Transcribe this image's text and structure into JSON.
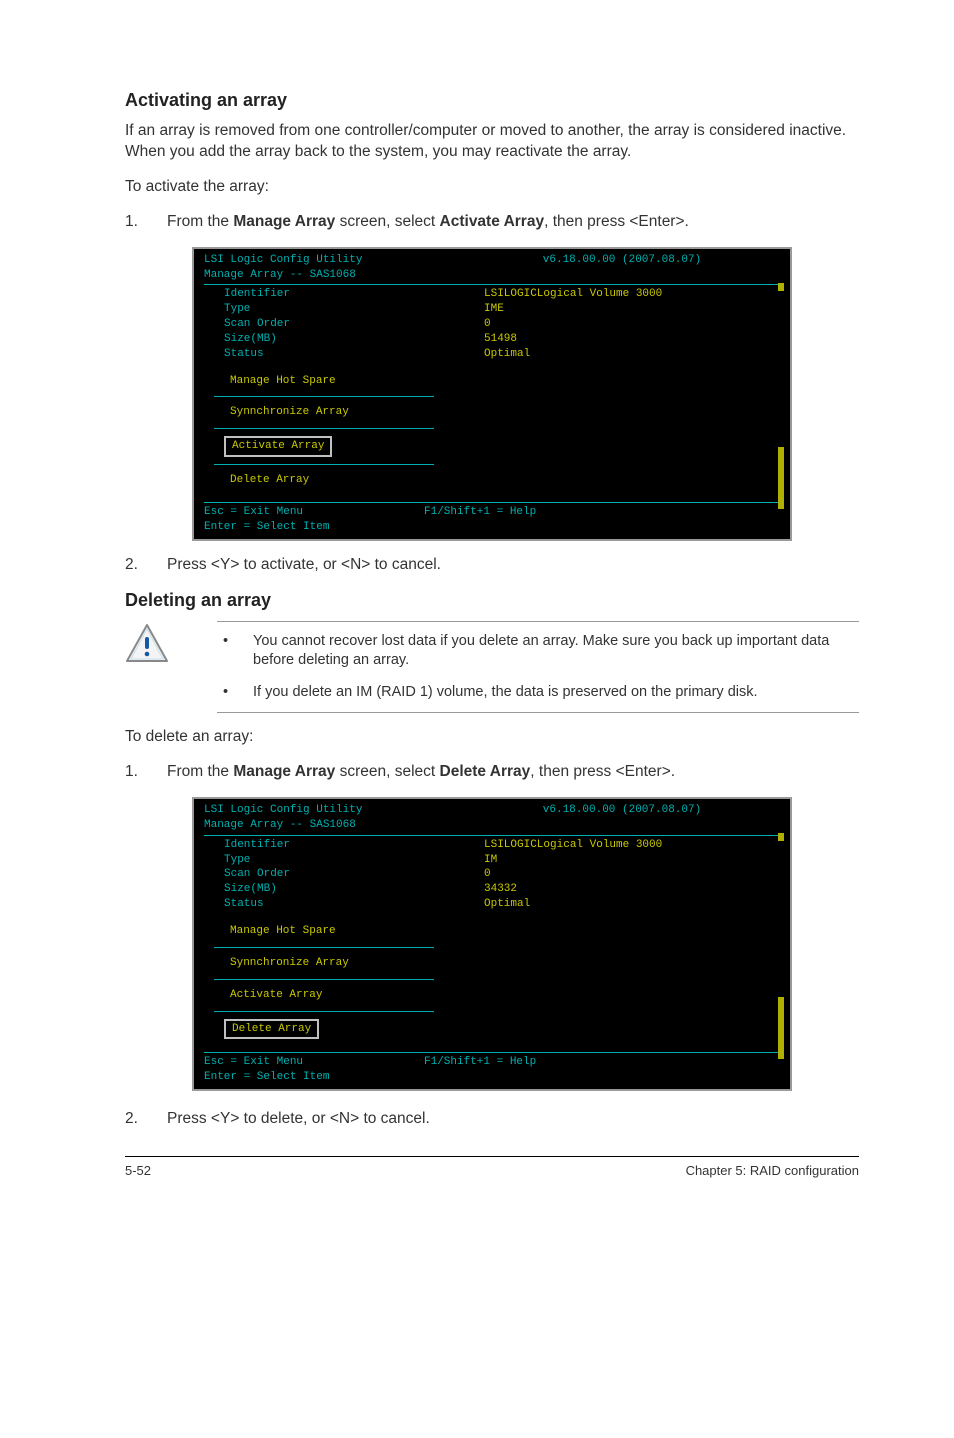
{
  "section1": {
    "heading": "Activating an array",
    "para1": "If an array is removed from one controller/computer or moved to another, the array is considered inactive. When you add the array back to the system, you may reactivate the array.",
    "para2": "To activate the array:",
    "step1_num": "1.",
    "step1_pre": "From the ",
    "step1_b1": "Manage Array",
    "step1_mid": " screen, select ",
    "step1_b2": "Activate Array",
    "step1_post": ", then press <Enter>.",
    "step2_num": "2.",
    "step2_text": "Press <Y> to activate, or <N> to cancel."
  },
  "terminal1": {
    "title_left": "LSI Logic Config Utility",
    "title_right": "v6.18.00.00 (2007.08.07)",
    "subtitle": "Manage Array -- SAS1068",
    "rows": {
      "identifier_label": "Identifier",
      "identifier_val": "LSILOGICLogical Volume  3000",
      "type_label": "Type",
      "type_val": "IME",
      "scan_label": "Scan Order",
      "scan_val": "0",
      "size_label": "Size(MB)",
      "size_val": "51498",
      "status_label": "Status",
      "status_val": "Optimal"
    },
    "menu": {
      "hot_spare": "Manage Hot Spare",
      "sync": "Synnchronize Array",
      "activate": "Activate Array",
      "delete": "Delete Array"
    },
    "footer": {
      "esc": "Esc = Exit Menu",
      "f1": "F1/Shift+1 = Help",
      "enter": "Enter = Select Item"
    }
  },
  "section2": {
    "heading": "Deleting an array",
    "callout_li1": "You cannot recover lost data if you delete an array. Make sure you back up important data before deleting an array.",
    "callout_li2": "If you delete an IM (RAID 1) volume, the data is preserved on the primary disk.",
    "para1": "To delete an array:",
    "step1_num": "1.",
    "step1_pre": "From the ",
    "step1_b1": "Manage Array",
    "step1_mid": " screen, select ",
    "step1_b2": "Delete Array",
    "step1_post": ", then press <Enter>.",
    "step2_num": "2.",
    "step2_text": "Press <Y> to delete, or <N> to cancel."
  },
  "terminal2": {
    "title_left": "LSI Logic Config Utility",
    "title_right": "v6.18.00.00 (2007.08.07)",
    "subtitle": "Manage Array -- SAS1068",
    "rows": {
      "identifier_label": "Identifier",
      "identifier_val": "LSILOGICLogical Volume  3000",
      "type_label": "Type",
      "type_val": "IM",
      "scan_label": "Scan Order",
      "scan_val": "0",
      "size_label": "Size(MB)",
      "size_val": "34332",
      "status_label": "Status",
      "status_val": "Optimal"
    },
    "menu": {
      "hot_spare": "Manage Hot Spare",
      "sync": "Synnchronize Array",
      "activate": "Activate Array",
      "delete": "Delete Array"
    },
    "footer": {
      "esc": "Esc = Exit Menu",
      "f1": "F1/Shift+1 = Help",
      "enter": "Enter = Select Item"
    }
  },
  "page_footer": {
    "left": "5-52",
    "right": "Chapter 5: RAID configuration"
  },
  "glyphs": {
    "bullet": "•"
  }
}
